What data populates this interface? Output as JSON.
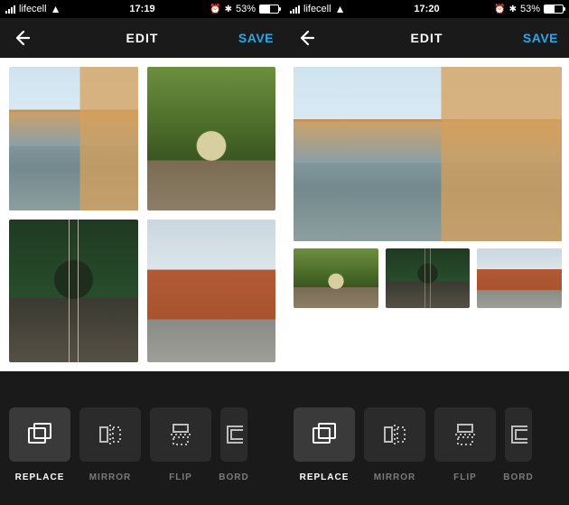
{
  "left": {
    "status": {
      "carrier": "lifecell",
      "time": "17:19",
      "battery_pct": "53%"
    },
    "nav": {
      "title": "EDIT",
      "save_label": "SAVE"
    },
    "images": [
      {
        "name": "river-buildings",
        "class": "river"
      },
      {
        "name": "tree-path-group",
        "class": "trees"
      },
      {
        "name": "green-tunnel",
        "class": "tunnel"
      },
      {
        "name": "brick-building",
        "class": "brick"
      }
    ],
    "tools": [
      {
        "id": "replace",
        "label": "REPLACE",
        "icon": "replace-icon",
        "selected": true
      },
      {
        "id": "mirror",
        "label": "MIRROR",
        "icon": "mirror-icon",
        "selected": false
      },
      {
        "id": "flip",
        "label": "FLIP",
        "icon": "flip-icon",
        "selected": false
      },
      {
        "id": "border",
        "label": "BORD",
        "icon": "border-icon",
        "selected": false
      }
    ]
  },
  "right": {
    "status": {
      "carrier": "lifecell",
      "time": "17:20",
      "battery_pct": "53%"
    },
    "nav": {
      "title": "EDIT",
      "save_label": "SAVE"
    },
    "hero": {
      "name": "river-buildings",
      "class": "river"
    },
    "thumbs": [
      {
        "name": "tree-path-group",
        "class": "trees"
      },
      {
        "name": "green-tunnel",
        "class": "tunnel"
      },
      {
        "name": "brick-building",
        "class": "brick"
      }
    ],
    "tools": [
      {
        "id": "replace",
        "label": "REPLACE",
        "icon": "replace-icon",
        "selected": true
      },
      {
        "id": "mirror",
        "label": "MIRROR",
        "icon": "mirror-icon",
        "selected": false
      },
      {
        "id": "flip",
        "label": "FLIP",
        "icon": "flip-icon",
        "selected": false
      },
      {
        "id": "border",
        "label": "BORD",
        "icon": "border-icon",
        "selected": false
      }
    ]
  }
}
